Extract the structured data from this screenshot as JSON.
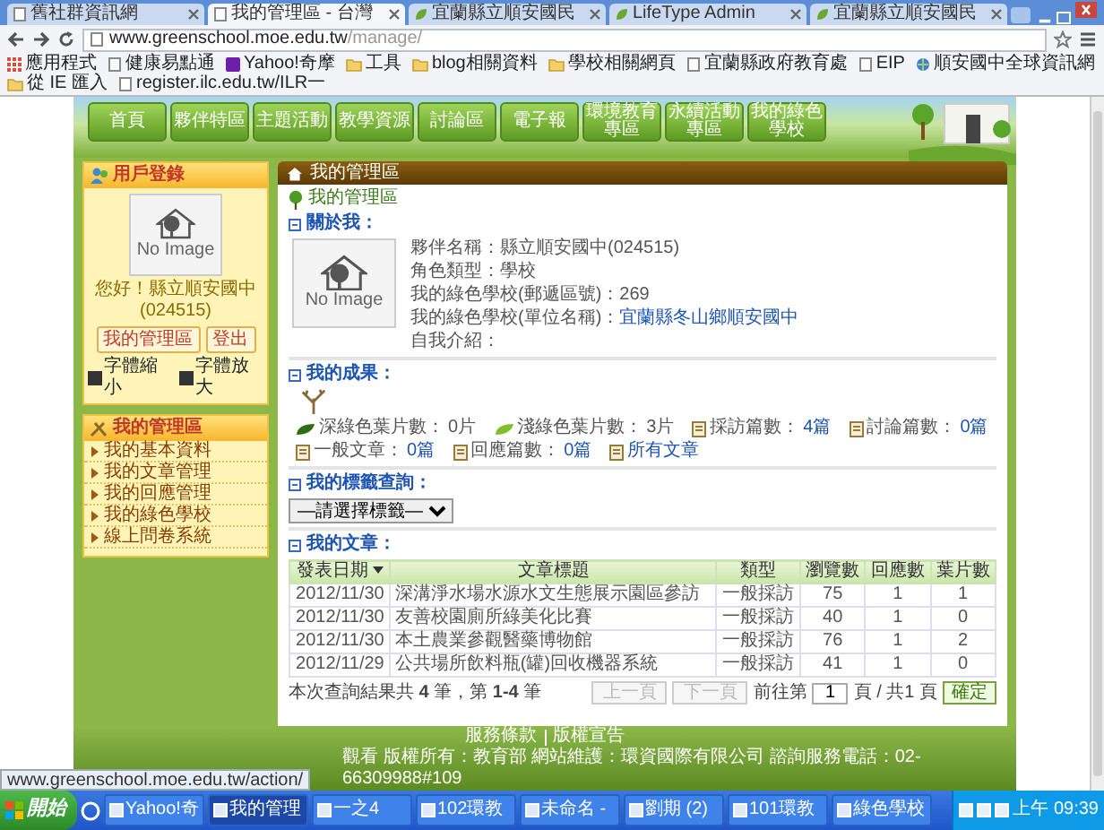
{
  "browser": {
    "tabs": [
      {
        "title": "舊社群資訊網",
        "selected": false
      },
      {
        "title": "我的管理區 - 台灣",
        "selected": true
      },
      {
        "title": "宜蘭縣立順安國民",
        "selected": false
      },
      {
        "title": "LifeType Admin",
        "selected": false
      },
      {
        "title": "宜蘭縣立順安國民",
        "selected": false
      }
    ],
    "address": {
      "host": "www.greenschool.moe.edu.tw",
      "path": "/manage/"
    },
    "bookmarks": [
      {
        "label": "應用程式",
        "kind": "apps"
      },
      {
        "label": "健康易點通",
        "kind": "page"
      },
      {
        "label": "Yahoo!奇摩",
        "kind": "yahoo"
      },
      {
        "label": "工具",
        "kind": "folder"
      },
      {
        "label": "blog相關資料",
        "kind": "folder"
      },
      {
        "label": "學校相關網頁",
        "kind": "folder"
      },
      {
        "label": "宜蘭縣政府教育處",
        "kind": "page"
      },
      {
        "label": "EIP",
        "kind": "page"
      },
      {
        "label": "順安國中全球資訊網",
        "kind": "globe"
      },
      {
        "label": "從 IE 匯入",
        "kind": "folder"
      },
      {
        "label": "register.ilc.edu.tw/ILR一",
        "kind": "page"
      }
    ]
  },
  "site": {
    "nav": [
      "首頁",
      "夥伴特區",
      "主題活動",
      "教學資源",
      "討論區",
      "電子報",
      "環境教育專區",
      "永續活動專區",
      "我的綠色學校"
    ],
    "login_panel": {
      "title": "用戶登錄",
      "image_text": "No Image",
      "greeting": "您好！縣立順安國中",
      "code": "(024515)",
      "buttons": [
        "我的管理區",
        "登出"
      ],
      "font_buttons": [
        "字體縮小",
        "字體放大"
      ]
    },
    "manage_panel": {
      "title": "我的管理區",
      "items": [
        "我的基本資料",
        "我的文章管理",
        "我的回應管理",
        "我的綠色學校",
        "線上問卷系統"
      ]
    },
    "breadcrumb": "我的管理區",
    "main": {
      "title": "我的管理區",
      "about": {
        "heading": "關於我：",
        "image_text": "No Image",
        "fields": [
          {
            "label": "夥伴名稱：",
            "value": "縣立順安國中(024515)",
            "link": false
          },
          {
            "label": "角色類型：",
            "value": "學校",
            "link": false
          },
          {
            "label": "我的綠色學校(郵遞區號)：",
            "value": "269",
            "link": false
          },
          {
            "label": "我的綠色學校(單位名稱)：",
            "value": "宜蘭縣冬山鄉順安國中",
            "link": true
          },
          {
            "label": "自我介紹："
          }
        ]
      },
      "results": {
        "heading": "我的成果：",
        "stats": [
          {
            "kind": "leaf",
            "color": "#2f6e12",
            "label": "深綠色葉片數：",
            "value": "0片"
          },
          {
            "kind": "leaf",
            "color": "#7fbf2e",
            "label": "淺綠色葉片數：",
            "value": "3片"
          },
          {
            "kind": "doc",
            "label": "採訪篇數：",
            "value": "4篇"
          },
          {
            "kind": "doc",
            "label": "討論篇數：",
            "value": "0篇"
          },
          {
            "kind": "doc",
            "label": "一般文章：",
            "value": "0篇"
          },
          {
            "kind": "doc",
            "label": "回應篇數：",
            "value": "0篇"
          },
          {
            "kind": "doc",
            "value": "所有文章"
          }
        ]
      },
      "tags": {
        "heading": "我的標籤查詢：",
        "select": "—請選擇標籤—"
      },
      "articles": {
        "heading": "我的文章：",
        "columns": [
          {
            "label": "發表日期",
            "sorted": true
          },
          {
            "label": "文章標題",
            "sorted": false
          },
          {
            "label": "類型",
            "sorted": false
          },
          {
            "label": "瀏覽數",
            "sorted": false
          },
          {
            "label": "回應數",
            "sorted": false
          },
          {
            "label": "葉片數",
            "sorted": false
          }
        ],
        "rows": [
          [
            "2012/11/30",
            "深溝淨水場水源水文生態展示園區參訪",
            "一般採訪",
            "75",
            "1",
            "1"
          ],
          [
            "2012/11/30",
            "友善校園廁所綠美化比賽",
            "一般採訪",
            "40",
            "1",
            "0"
          ],
          [
            "2012/11/30",
            "本土農業參觀醫藥博物館",
            "一般採訪",
            "76",
            "1",
            "2"
          ],
          [
            "2012/11/29",
            "公共場所飲料瓶(罐)回收機器系統",
            "一般採訪",
            "41",
            "1",
            "0"
          ]
        ],
        "summary": "本次查詢結果共 **4** 筆，第 **1-4** 筆",
        "pager": {
          "prev": "上一頁",
          "next": "下一頁",
          "prev_disabled": true,
          "next_disabled": true,
          "goto_before": "前往第",
          "page": "1",
          "goto_after": "頁 / 共1 頁",
          "go": "確定"
        }
      }
    },
    "footer": {
      "links": [
        "服務條款",
        "版權宣告"
      ],
      "info": "觀看 版權所有：教育部 網站維護：環資國際有限公司 諮詢服務電話：02-66309988#109"
    }
  },
  "status_bar": "www.greenschool.moe.edu.tw/action/",
  "taskbar": {
    "start": "開始",
    "items": [
      {
        "label": "Yahoo!奇",
        "selected": false
      },
      {
        "label": "我的管理",
        "selected": true
      },
      {
        "label": "一之4",
        "selected": false
      },
      {
        "label": "102環教",
        "selected": false
      },
      {
        "label": "未命名 -",
        "selected": false
      },
      {
        "label": "劉期 (2)",
        "selected": false
      },
      {
        "label": "101環教",
        "selected": false
      },
      {
        "label": "綠色學校",
        "selected": false
      }
    ],
    "clock": "上午 09:39"
  }
}
